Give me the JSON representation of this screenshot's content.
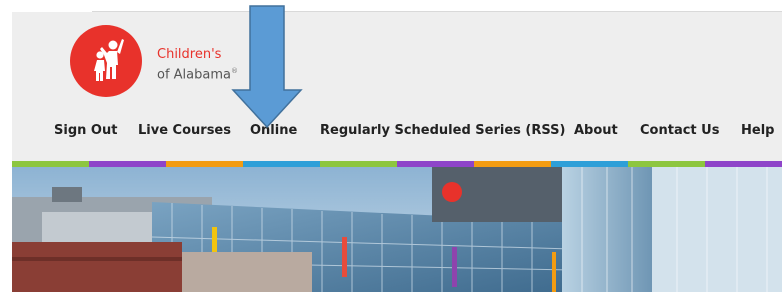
{
  "brand": {
    "line1": "Children's",
    "line2": "of Alabama",
    "reg": "®"
  },
  "nav": {
    "items": [
      {
        "label": "Sign Out"
      },
      {
        "label": "Live Courses"
      },
      {
        "label": "Online"
      },
      {
        "label": "Regularly Scheduled Series (RSS)"
      },
      {
        "label": "About"
      },
      {
        "label": "Contact Us"
      },
      {
        "label": "Help"
      }
    ]
  },
  "colors": {
    "brand_red": "#e8322b",
    "header_bg": "#eeeeee",
    "arrow_fill": "#5b9bd5",
    "arrow_stroke": "#41719c",
    "stripe": [
      "#8dc63f",
      "#8e44c9",
      "#f39c12",
      "#2e9fd8",
      "#8dc63f",
      "#8e44c9",
      "#f39c12",
      "#2e9fd8",
      "#8dc63f",
      "#8e44c9"
    ]
  },
  "icons": {
    "logo": "children-figures-icon",
    "annotation": "down-arrow-icon"
  }
}
